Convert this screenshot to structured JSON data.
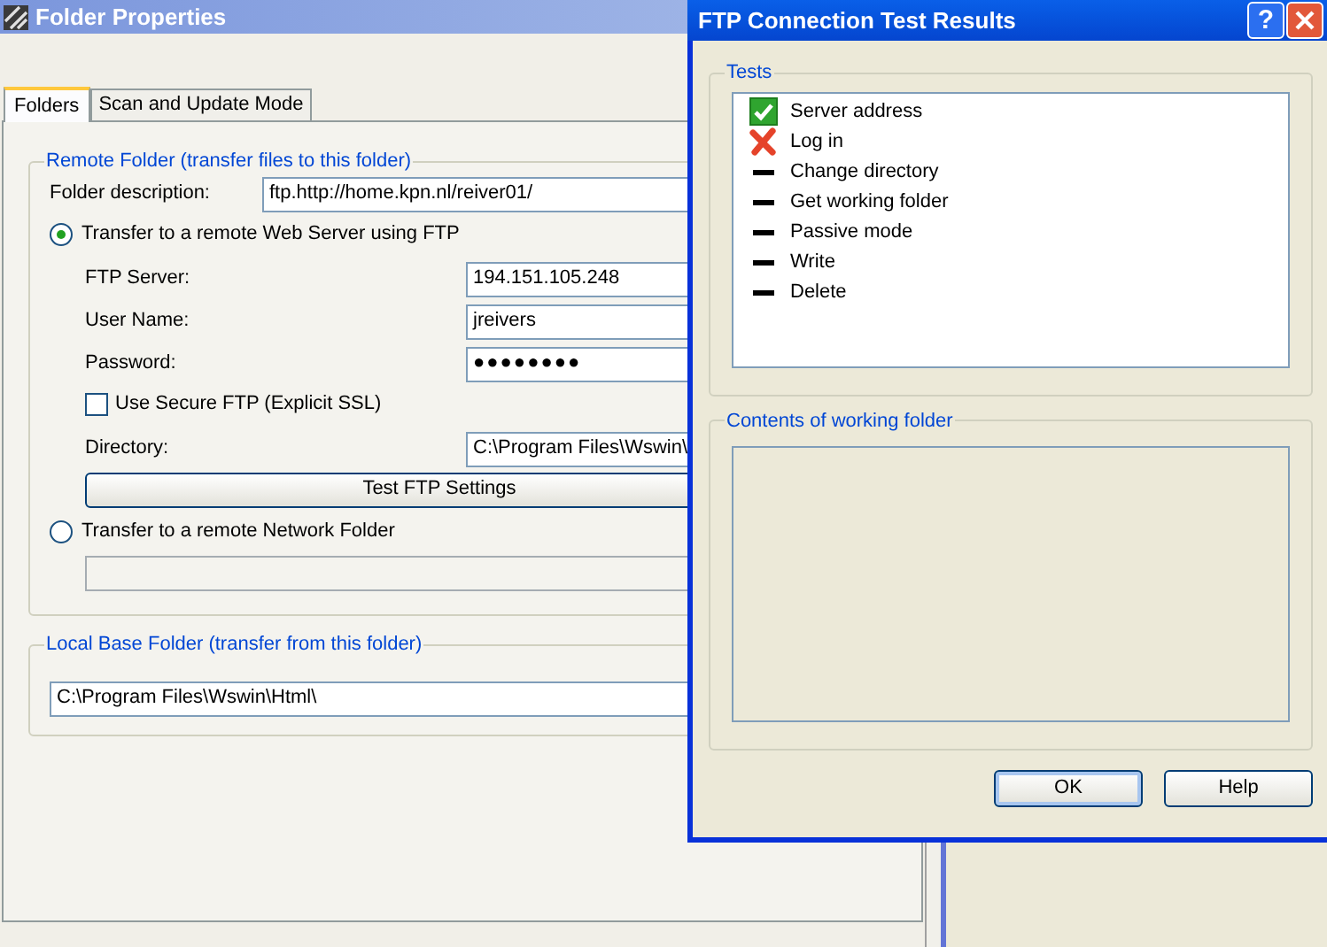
{
  "main_window": {
    "title": "Folder Properties",
    "tabs": [
      {
        "label": "Folders",
        "selected": true
      },
      {
        "label": "Scan and Update Mode",
        "selected": false
      }
    ],
    "remote_folder": {
      "legend": "Remote Folder (transfer files to this folder)",
      "folder_description": {
        "label": "Folder description:",
        "value": "ftp.http://home.kpn.nl/reiver01/"
      },
      "ftp_option": {
        "label": "Transfer to a remote Web Server using FTP",
        "selected": true
      },
      "ftp_server": {
        "label": "FTP Server:",
        "value": "194.151.105.248"
      },
      "user_name": {
        "label": "User Name:",
        "value": "jreivers"
      },
      "password": {
        "label": "Password:",
        "value": "●●●●●●●●"
      },
      "secure_ftp": {
        "label": "Use Secure FTP (Explicit SSL)",
        "checked": false
      },
      "directory": {
        "label": "Directory:",
        "value": "C:\\Program Files\\Wswin\\"
      },
      "test_button": "Test FTP Settings",
      "network_option": {
        "label": "Transfer to a remote Network Folder",
        "selected": false
      }
    },
    "local_folder": {
      "legend": "Local Base Folder (transfer from this folder)",
      "value": "C:\\Program Files\\Wswin\\Html\\"
    }
  },
  "dialog": {
    "title": "FTP Connection Test Results",
    "help_button": "?",
    "tests_legend": "Tests",
    "tests": [
      {
        "label": "Server address",
        "kind": "pass"
      },
      {
        "label": "Log in",
        "kind": "fail"
      },
      {
        "label": "Change directory",
        "kind": "none"
      },
      {
        "label": "Get working folder",
        "kind": "none"
      },
      {
        "label": "Passive mode",
        "kind": "none"
      },
      {
        "label": "Write",
        "kind": "none"
      },
      {
        "label": "Delete",
        "kind": "none"
      }
    ],
    "contents_legend": "Contents of working folder",
    "buttons": [
      "OK",
      "Help"
    ]
  }
}
